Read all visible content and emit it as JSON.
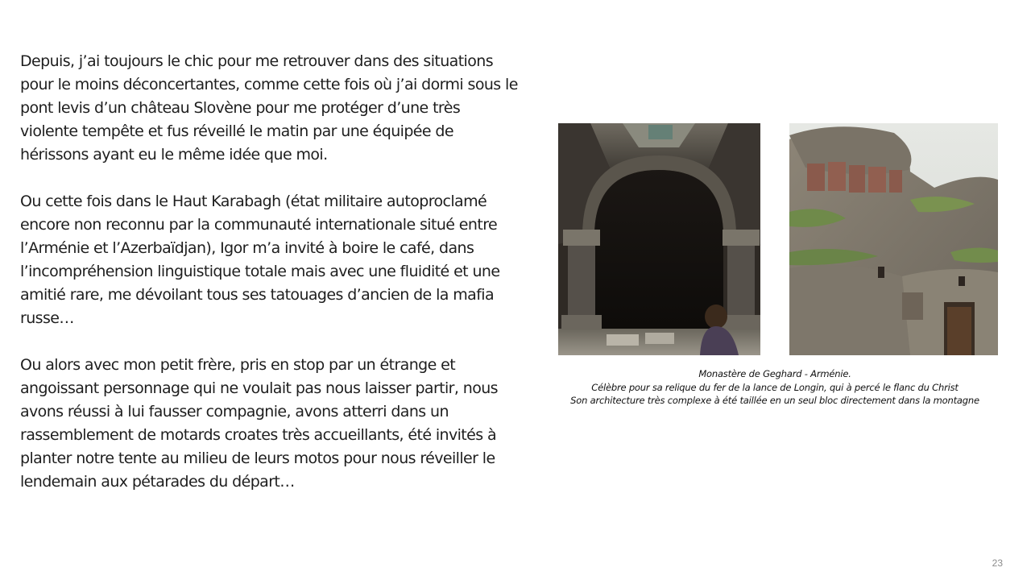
{
  "slide": {
    "paragraphs": [
      "Depuis, j’ai toujours le chic pour me retrouver dans des situations pour le moins déconcertantes, comme cette fois où j’ai dormi sous le pont levis d’un château Slovène pour me protéger d’une très violente tempête et fus réveillé le matin par une équipée de hérissons ayant eu le même idée que moi.",
      "Ou cette fois dans le Haut Karabagh (état militaire autoproclamé encore non reconnu par la communauté internationale situé entre l’Arménie et l’Azerbaïdjan), Igor m’a invité à boire le café, dans l’incompréhension linguistique totale mais avec une fluidité et une amitié rare, me dévoilant tous ses tatouages d’ancien de la mafia russe…",
      "Ou alors avec mon petit frère, pris en stop par un étrange et angoissant personnage qui ne voulait pas nous laisser partir, nous avons réussi à lui fausser compagnie, avons atterri dans un rassemblement de motards croates très accueillants, été invités à planter notre tente au milieu de leurs motos pour nous réveiller le lendemain aux pétarades du départ…"
    ],
    "caption": {
      "line1": "Monastère de Geghard - Arménie.",
      "line2": "Célèbre pour sa relique du fer de la lance de Longin, qui à percé le flanc du Christ",
      "line3": "Son architecture très complexe à été taillée en un seul bloc directement dans la montagne"
    },
    "page_number": "23"
  }
}
